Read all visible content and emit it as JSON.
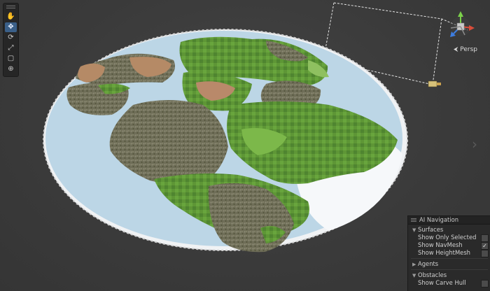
{
  "scene": {
    "view_mode_label": "Persp",
    "tools": [
      {
        "name": "hand-tool",
        "icon": "hand-icon",
        "glyph": "✋",
        "active": false
      },
      {
        "name": "move-tool",
        "icon": "move-icon",
        "glyph": "✥",
        "active": true
      },
      {
        "name": "rotate-tool",
        "icon": "rotate-icon",
        "glyph": "⟳",
        "active": false
      },
      {
        "name": "scale-tool",
        "icon": "scale-icon",
        "glyph": "⤢",
        "active": false
      },
      {
        "name": "rect-tool",
        "icon": "rect-transform-icon",
        "glyph": "▢",
        "active": false
      },
      {
        "name": "transform-tool",
        "icon": "transform-icon",
        "glyph": "⊕",
        "active": false
      }
    ],
    "colors": {
      "water": "#b9d4e4",
      "grass": "#5f9a38",
      "forest": "#6d6d55",
      "dirt": "#b08562",
      "toolbar_active": "#3a5f88"
    }
  },
  "ai_navigation": {
    "title": "AI Navigation",
    "surfaces": {
      "label": "Surfaces",
      "options": [
        {
          "label": "Show Only Selected",
          "checked": false
        },
        {
          "label": "Show NavMesh",
          "checked": true
        },
        {
          "label": "Show HeightMesh",
          "checked": false
        }
      ]
    },
    "agents": {
      "label": "Agents"
    },
    "obstacles": {
      "label": "Obstacles",
      "options": [
        {
          "label": "Show Carve Hull",
          "checked": false
        }
      ]
    }
  }
}
